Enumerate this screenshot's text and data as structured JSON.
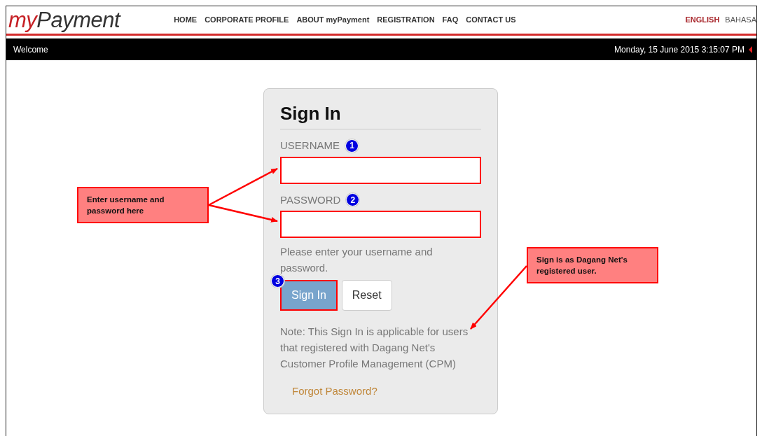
{
  "logo": {
    "first": "my",
    "second": "Payment"
  },
  "nav": [
    {
      "label": "HOME"
    },
    {
      "label": "CORPORATE PROFILE"
    },
    {
      "label": "ABOUT myPayment"
    },
    {
      "label": "REGISTRATION"
    },
    {
      "label": "FAQ"
    },
    {
      "label": "CONTACT US"
    }
  ],
  "languages": [
    {
      "label": "ENGLISH",
      "selected": true
    },
    {
      "label": "BAHASA",
      "selected": false
    }
  ],
  "welcome_bar": {
    "greeting": "Welcome",
    "datetime": "Monday, 15 June 2015 3:15:07 PM"
  },
  "sign_in": {
    "title": "Sign In",
    "fields": [
      {
        "label": "USERNAME",
        "step": "1",
        "highlighted": true
      },
      {
        "label": "PASSWORD",
        "step": "2",
        "highlighted": true
      }
    ],
    "help": "Please enter your username and password.",
    "buttons": [
      {
        "kind": "primary",
        "label": "Sign In",
        "step": "3",
        "highlighted": true
      },
      {
        "kind": "secondary",
        "label": "Reset",
        "highlighted": false
      }
    ],
    "note": "Note: This Sign In is applicable for users that registered with Dagang Net's Customer Profile Management (CPM)",
    "forgot_link": "Forgot Password?"
  },
  "callouts": [
    {
      "text": "Enter username and password here"
    },
    {
      "text": "Sign is as Dagang Net's registered user."
    }
  ]
}
